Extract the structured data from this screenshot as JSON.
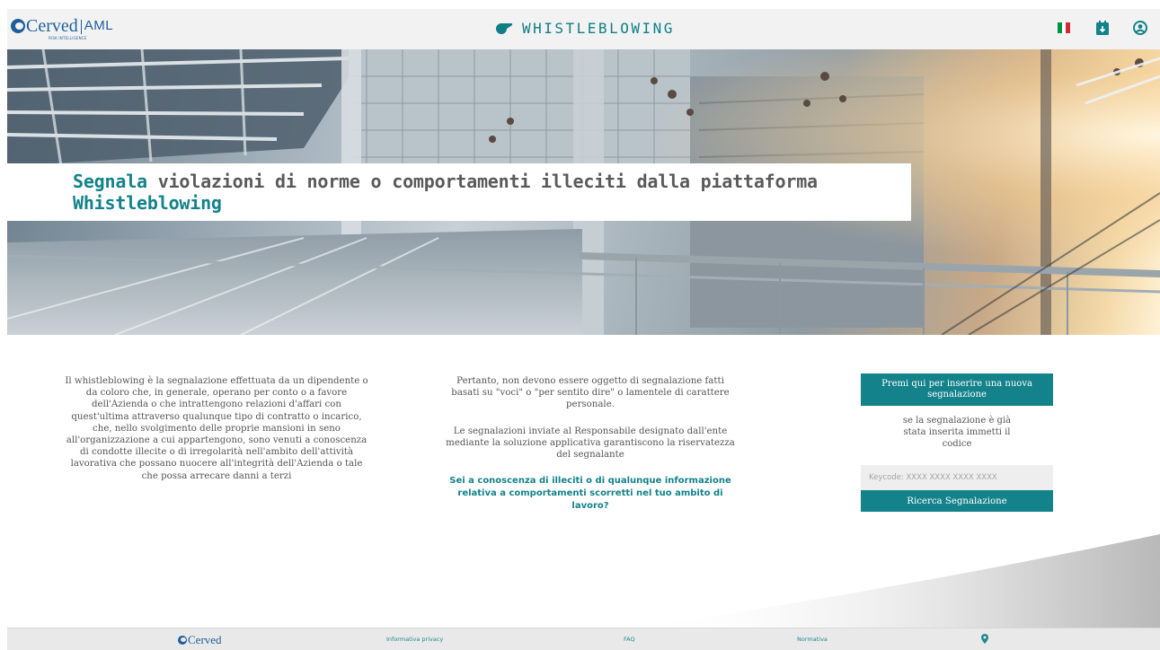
{
  "header": {
    "logo_text": "Cerved",
    "logo_product": "AML",
    "logo_tagline": "RISK INTELLIGENCE",
    "app_name": "WHISTLEBLOWING",
    "flag_colors": [
      "#009246",
      "#ffffff",
      "#ce2b37"
    ],
    "icons": [
      "italy-flag-icon",
      "calendar-download-icon",
      "user-circle-icon"
    ]
  },
  "hero": {
    "title_highlight_1": "Segnala",
    "title_middle": " violazioni di norme o comportamenti illeciti dalla piattaforma ",
    "title_highlight_2": "Whistleblowing"
  },
  "content": {
    "definition": "Il whistleblowing è la segnalazione effettuata da un dipendente o da coloro che, in generale, operano per conto o a favore dell'Azienda o che intrattengono relazioni d'affari con quest'ultima attraverso qualunque tipo di contratto o incarico, che, nello svolgimento delle proprie mansioni in seno all'organizzazione a cui appartengono, sono venuti a conoscenza di condotte illecite o di irregolarità nell'ambito dell'attività lavorativa che possano nuocere all'integrità dell'Azienda o tale che possa arrecare danni a terzi",
    "note_1": "Pertanto, non devono essere oggetto di segnalazione fatti basati su \"voci\" o \"per sentito dire\" o lamentele di carattere personale.",
    "note_2": "Le segnalazioni inviate al Responsabile designato dall'ente mediante la soluzione applicativa garantiscono la riservatezza del segnalante",
    "cta_question": "Sei a conoscenza di illeciti o di qualunque informazione relativa a comportamenti scorretti nel tuo ambito di lavoro?"
  },
  "actions": {
    "new_report_label": "Premi qui per inserire una nuova segnalazione",
    "existing_hint": "se la segnalazione è già stata inserita immetti il codice",
    "keycode_placeholder": "Keycode: XXXX XXXX XXXX XXXX",
    "search_label": "Ricerca Segnalazione"
  },
  "footer": {
    "logo_text": "Cerved",
    "links": [
      "Informativa privacy",
      "FAQ",
      "Normativa"
    ],
    "icons": [
      "location-pin-icon"
    ]
  },
  "colors": {
    "accent": "#13828a",
    "brand_blue": "#1c5f9c"
  }
}
